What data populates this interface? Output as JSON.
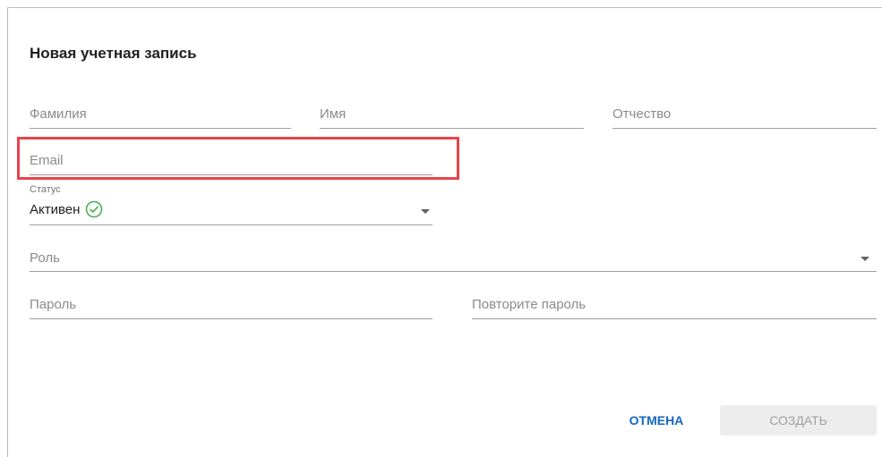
{
  "dialog": {
    "title": "Новая учетная запись"
  },
  "form": {
    "last_name": {
      "placeholder": "Фамилия",
      "value": ""
    },
    "first_name": {
      "placeholder": "Имя",
      "value": ""
    },
    "middle_name": {
      "placeholder": "Отчество",
      "value": ""
    },
    "email": {
      "placeholder": "Email",
      "value": ""
    },
    "status": {
      "label": "Статус",
      "value": "Активен",
      "icon": "check-circle-icon",
      "icon_color": "#4caf50"
    },
    "role": {
      "placeholder": "Роль",
      "value": ""
    },
    "password": {
      "placeholder": "Пароль",
      "value": ""
    },
    "password_repeat": {
      "placeholder": "Повторите пароль",
      "value": ""
    }
  },
  "actions": {
    "cancel_label": "ОТМЕНА",
    "create_label": "СОЗДАТЬ"
  },
  "colors": {
    "accent": "#1565c0",
    "highlight": "#e8434a",
    "disabled_bg": "#ededed"
  }
}
